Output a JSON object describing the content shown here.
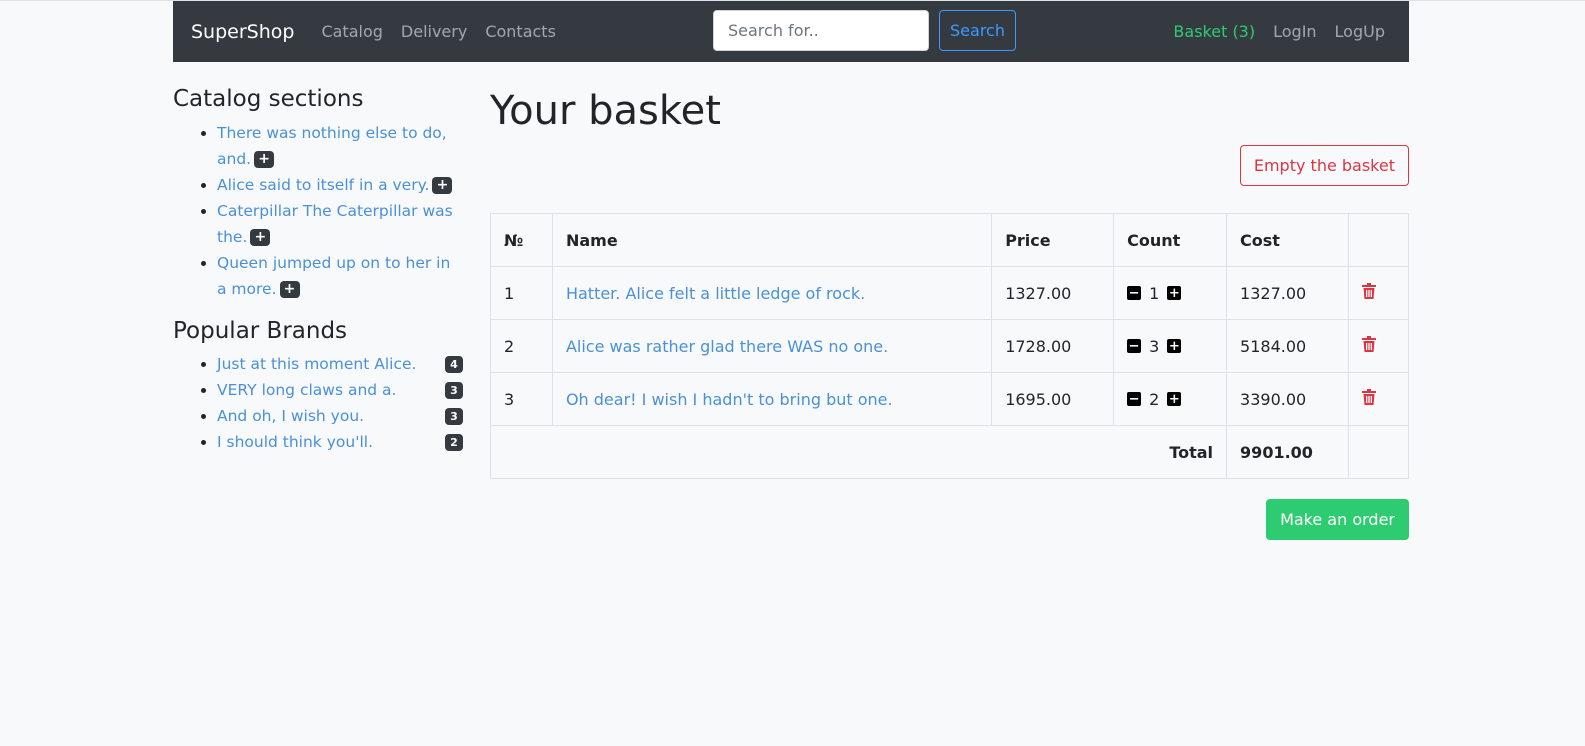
{
  "navbar": {
    "brand": "SuperShop",
    "links": [
      "Catalog",
      "Delivery",
      "Contacts"
    ],
    "search_placeholder": "Search for..",
    "search_button": "Search",
    "basket": "Basket (3)",
    "login": "LogIn",
    "logup": "LogUp"
  },
  "sidebar": {
    "catalog_title": "Catalog sections",
    "catalog_items": [
      "There was nothing else to do, and.",
      "Alice said to itself in a very.",
      "Caterpillar The Caterpillar was the.",
      "Queen jumped up on to her in a more."
    ],
    "brands_title": "Popular Brands",
    "brands": [
      {
        "name": "Just at this moment Alice.",
        "count": "4"
      },
      {
        "name": "VERY long claws and a.",
        "count": "3"
      },
      {
        "name": "And oh, I wish you.",
        "count": "3"
      },
      {
        "name": "I should think you'll.",
        "count": "2"
      }
    ]
  },
  "main": {
    "title": "Your basket",
    "empty_button": "Empty the basket",
    "table_headers": [
      "№",
      "Name",
      "Price",
      "Count",
      "Cost",
      ""
    ],
    "rows": [
      {
        "n": "1",
        "name": "Hatter. Alice felt a little ledge of rock.",
        "price": "1327.00",
        "count": "1",
        "cost": "1327.00"
      },
      {
        "n": "2",
        "name": "Alice was rather glad there WAS no one.",
        "price": "1728.00",
        "count": "3",
        "cost": "5184.00"
      },
      {
        "n": "3",
        "name": "Oh dear! I wish I hadn't to bring but one.",
        "price": "1695.00",
        "count": "2",
        "cost": "3390.00"
      }
    ],
    "total_label": "Total",
    "total_value": "9901.00",
    "order_button": "Make an order"
  },
  "colors": {
    "navbar_bg": "#343a40",
    "link": "#4a90d9",
    "success": "#2ecc71",
    "danger": "#dc3545"
  }
}
